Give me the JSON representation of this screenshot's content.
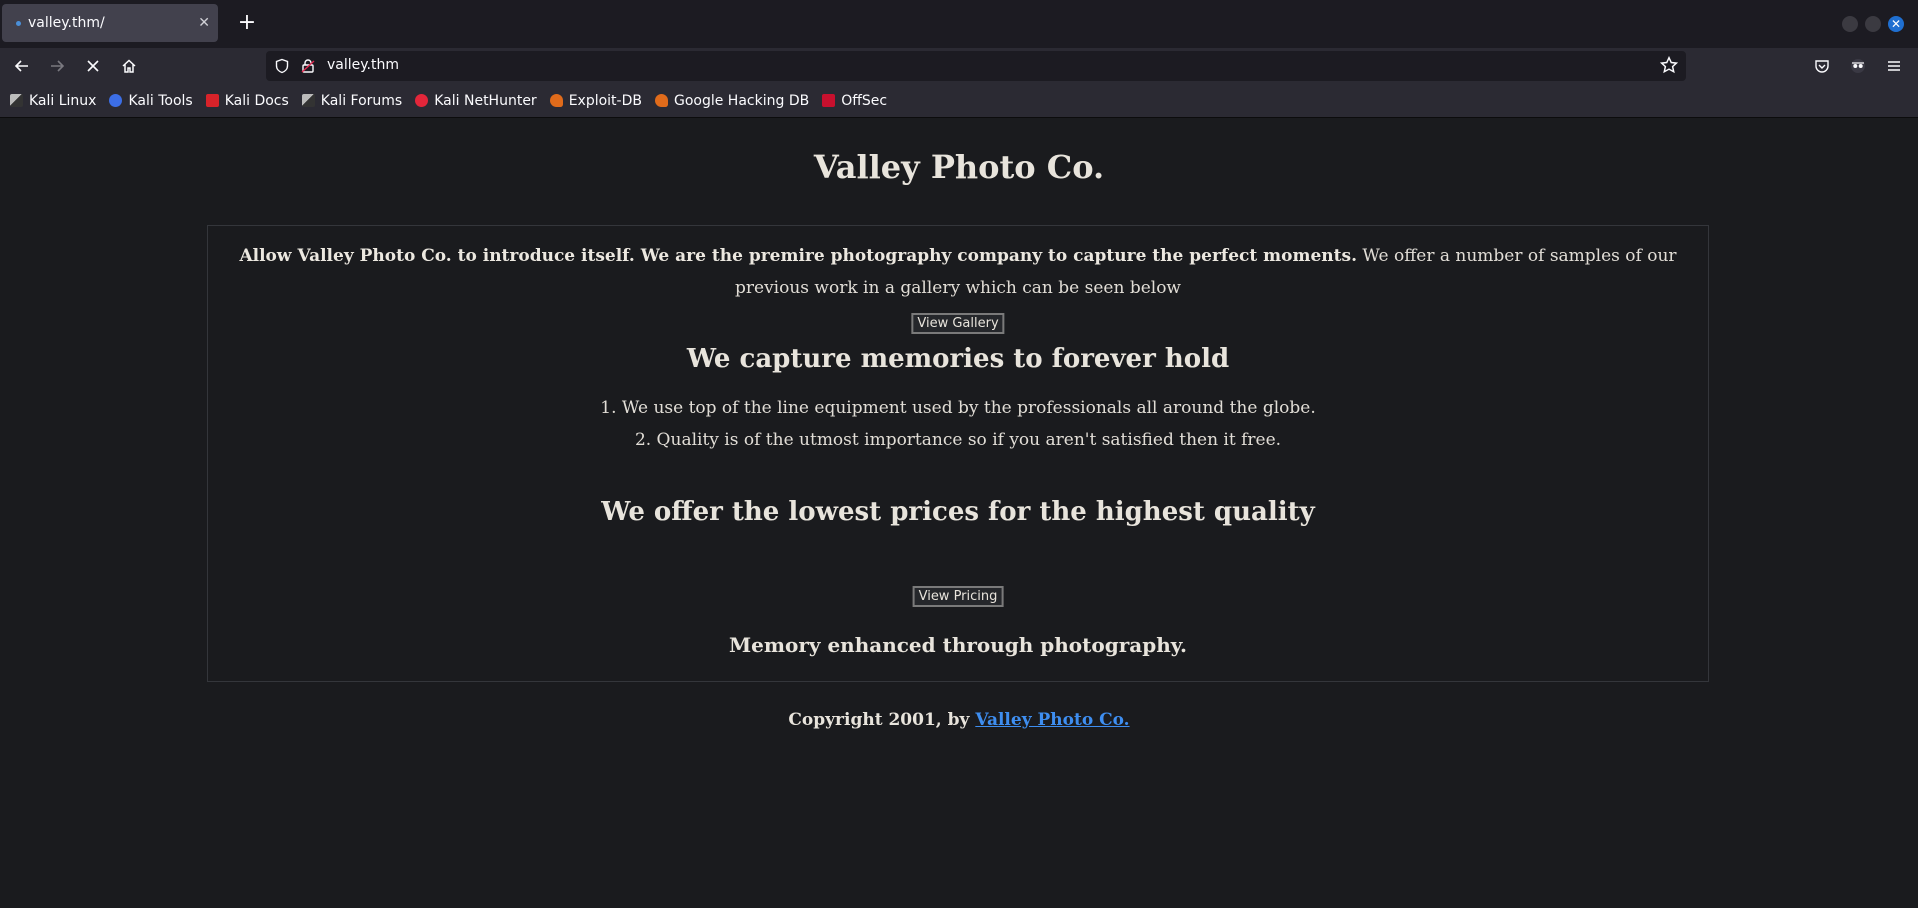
{
  "browser": {
    "tab_title": "valley.thm/",
    "tab_close": "✕",
    "new_tab": "+",
    "url": "valley.thm",
    "window_close": "✕"
  },
  "bookmarks": [
    {
      "label": "Kali Linux",
      "icon": "kali-dragon-icon",
      "color": "#3a3a3a"
    },
    {
      "label": "Kali Tools",
      "icon": "kali-tools-icon",
      "color": "#3c6ee6"
    },
    {
      "label": "Kali Docs",
      "icon": "kali-docs-icon",
      "color": "#d8232a"
    },
    {
      "label": "Kali Forums",
      "icon": "kali-forums-icon",
      "color": "#3a3a3a"
    },
    {
      "label": "Kali NetHunter",
      "icon": "nethunter-icon",
      "color": "#e3263a"
    },
    {
      "label": "Exploit-DB",
      "icon": "exploit-db-icon",
      "color": "#e06b1b"
    },
    {
      "label": "Google Hacking DB",
      "icon": "ghdb-icon",
      "color": "#e06b1b"
    },
    {
      "label": "OffSec",
      "icon": "offsec-icon",
      "color": "#c8102e"
    }
  ],
  "page": {
    "title": "Valley Photo Co.",
    "intro_bold": "Allow Valley Photo Co. to introduce itself. We are the premire photography company to capture the perfect moments.",
    "intro_rest": " We offer a number of samples of our previous work in a gallery which can be seen below",
    "gallery_button": "View Gallery",
    "heading_memories": "We capture memories to forever hold",
    "features": [
      "1. We use top of the line equipment used by the professionals all around the globe.",
      "2. Quality is of the utmost importance so if you aren't satisfied then it free."
    ],
    "heading_prices": "We offer the lowest prices for the highest quality",
    "pricing_button": "View Pricing",
    "tagline": "Memory enhanced through photography.",
    "footer_prefix": "Copyright 2001, by ",
    "footer_link": "Valley Photo Co."
  },
  "colors": {
    "link": "#3e8ef0",
    "page_background": "#1a1b1e",
    "chrome_background": "#2b2a33"
  }
}
